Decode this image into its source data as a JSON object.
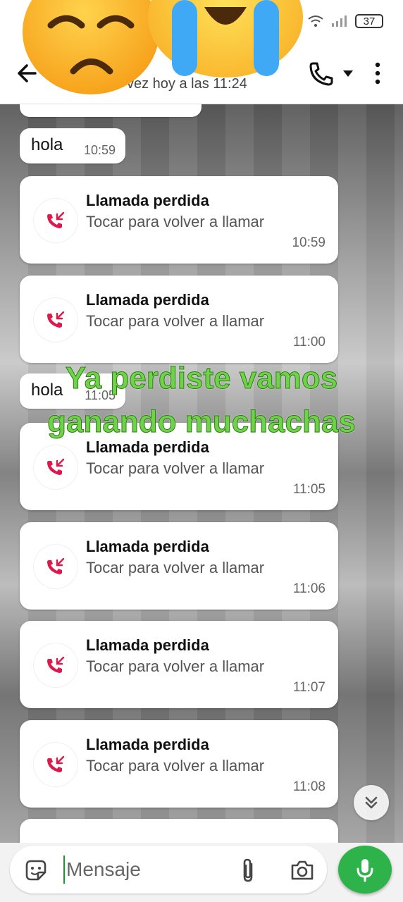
{
  "status_bar": {
    "battery": "37"
  },
  "header": {
    "last_seen": "vez hoy a las 11:24"
  },
  "messages": [
    {
      "type": "text",
      "text": "hola",
      "time": "10:59"
    },
    {
      "type": "call",
      "title": "Llamada perdida",
      "subtitle": "Tocar para volver a llamar",
      "time": "10:59"
    },
    {
      "type": "call",
      "title": "Llamada perdida",
      "subtitle": "Tocar para volver a llamar",
      "time": "11:00"
    },
    {
      "type": "text",
      "text": "hola",
      "time": "11:05"
    },
    {
      "type": "call",
      "title": "Llamada perdida",
      "subtitle": "Tocar para volver a llamar",
      "time": "11:05"
    },
    {
      "type": "call",
      "title": "Llamada perdida",
      "subtitle": "Tocar para volver a llamar",
      "time": "11:06"
    },
    {
      "type": "call",
      "title": "Llamada perdida",
      "subtitle": "Tocar para volver a llamar",
      "time": "11:07"
    },
    {
      "type": "call",
      "title": "Llamada perdida",
      "subtitle": "Tocar para volver a llamar",
      "time": "11:08"
    }
  ],
  "overlay_caption": {
    "line1": "Ya perdiste vamos",
    "line2": "ganando muchachas"
  },
  "composer": {
    "placeholder": "Mensaje"
  },
  "colors": {
    "missed_call_red": "#e0174b",
    "accent_green": "#2db34a",
    "caption_green": "#6ed24a"
  },
  "icons": [
    "back-arrow-icon",
    "phone-icon",
    "caret-down-icon",
    "more-vert-icon",
    "missed-call-icon",
    "chevrons-down-icon",
    "sticker-icon",
    "paperclip-icon",
    "camera-icon",
    "mic-icon",
    "wifi-icon",
    "signal-icon",
    "battery-icon"
  ]
}
